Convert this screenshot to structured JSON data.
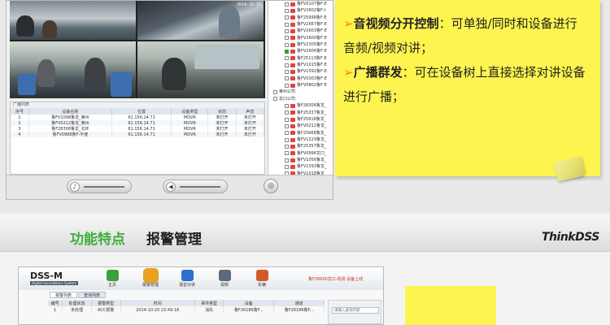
{
  "colors": {
    "accent_green": "#3cae3a",
    "note_yellow": "#fdf44f",
    "bullet_orange": "#f08c00",
    "status_red": "#c0392b"
  },
  "top": {
    "videos": [
      {
        "label": "",
        "stamp": ""
      },
      {
        "label": "",
        "stamp": "2014-10-15"
      },
      {
        "label": "",
        "stamp": ""
      },
      {
        "label": "",
        "stamp": ""
      }
    ],
    "device_tree": [
      {
        "text": "鲁FV0107鲁F-E",
        "group": false,
        "checked": false
      },
      {
        "text": "鲁FV2602鲁F-I",
        "group": false,
        "checked": false
      },
      {
        "text": "鲁F25998鲁F-E",
        "group": false,
        "checked": false
      },
      {
        "text": "鲁FV2667鲁F-E",
        "group": false,
        "checked": false
      },
      {
        "text": "鲁FV2603鲁F-E",
        "group": false,
        "checked": false
      },
      {
        "text": "鲁FV2600鲁F-E",
        "group": false,
        "checked": false
      },
      {
        "text": "鲁FV2305鲁F-E",
        "group": false,
        "checked": false
      },
      {
        "text": "鲁FV2606鲁F-E",
        "group": false,
        "checked": true
      },
      {
        "text": "鲁F25113鲁F-E",
        "group": false,
        "checked": false
      },
      {
        "text": "鲁FV1015鲁F-E",
        "group": false,
        "checked": false
      },
      {
        "text": "鲁FV1592鲁F-E",
        "group": false,
        "checked": false
      },
      {
        "text": "鲁FV0303鲁F-E",
        "group": false,
        "checked": false
      },
      {
        "text": "鲁FV0802鲁F-E",
        "group": false,
        "checked": false
      },
      {
        "text": "莱州公司",
        "group": true,
        "checked": false
      },
      {
        "text": "龙口公司",
        "group": true,
        "checked": false
      },
      {
        "text": "鲁F28306鲁龙_",
        "group": false,
        "checked": false
      },
      {
        "text": "鲁F25337鲁龙_",
        "group": false,
        "checked": false
      },
      {
        "text": "鲁F25618鲁龙_",
        "group": false,
        "checked": false
      },
      {
        "text": "鲁FV0212鲁龙_",
        "group": false,
        "checked": false
      },
      {
        "text": "鲁F25668鲁龙_",
        "group": false,
        "checked": false
      },
      {
        "text": "鲁FV1229鲁龙_",
        "group": false,
        "checked": false
      },
      {
        "text": "鲁F25357鲁龙_",
        "group": false,
        "checked": false
      },
      {
        "text": "鲁FV0996龙口_",
        "group": false,
        "checked": false
      },
      {
        "text": "鲁FV1056鲁龙_",
        "group": false,
        "checked": false
      },
      {
        "text": "鲁FV1593鲁龙_",
        "group": false,
        "checked": false
      },
      {
        "text": "鲁FV1018鲁龙_",
        "group": false,
        "checked": false
      }
    ],
    "alarm_list": {
      "title": "广播列表",
      "headers": [
        "序号",
        "设备名称",
        "位置",
        "设备类型",
        "状态",
        "声音"
      ],
      "rows": [
        [
          "1",
          "鲁FV1098鲁龙_莱州",
          "61.156.14.71",
          "MDVR",
          "未打开",
          "未打开"
        ],
        [
          "2",
          "鲁FV0212鲁龙_莱州",
          "61.156.14.71",
          "MDVR",
          "未打开",
          "未打开"
        ],
        [
          "3",
          "鲁F28306鲁龙_北环",
          "61.156.14.71",
          "MDVR",
          "未打开",
          "未打开"
        ],
        [
          "4",
          "鲁FV0988鲁F-平度",
          "61.156.14.71",
          "MDVR",
          "未打开",
          "未打开"
        ]
      ]
    },
    "note": {
      "bullet": "➢",
      "item1_title": "音视频分开控制",
      "item1_text": "：可单独/同时和设备进行音频/视频对讲；",
      "item2_title": "广播群发",
      "item2_text": "：可在设备树上直接选择对讲设备进行广播；"
    }
  },
  "bottom": {
    "feature_title": "功能特点",
    "section_title": "报警管理",
    "brand": "ThinkDSS",
    "app": {
      "logo": "DSS-M",
      "subtitle": "Digital Surveillance System",
      "modules": [
        {
          "label": "主页",
          "color": "#3aa13a"
        },
        {
          "label": "报警管理",
          "color": "#e8a21b"
        },
        {
          "label": "语音对讲",
          "color": "#2d6fd0"
        },
        {
          "label": "视频",
          "color": "#5b6b7b"
        },
        {
          "label": "车辆",
          "color": "#d05a2a"
        }
      ],
      "status": "鲁F28690龙口-机场  设备上线",
      "tabs": [
        "报警列表",
        "查询列表"
      ],
      "table_headers": [
        "编号",
        "处理状态",
        "报警类型",
        "时间",
        "事件类型",
        "设备",
        "通道"
      ],
      "table_rows": [
        [
          "1",
          "未处理",
          "ACC报警",
          "2014-10-20 22:49:16",
          "消失",
          "鲁F26186鲁F...",
          "鲁F26186鲁F..."
        ]
      ],
      "search_placeholder": "请输入查询内容"
    }
  }
}
